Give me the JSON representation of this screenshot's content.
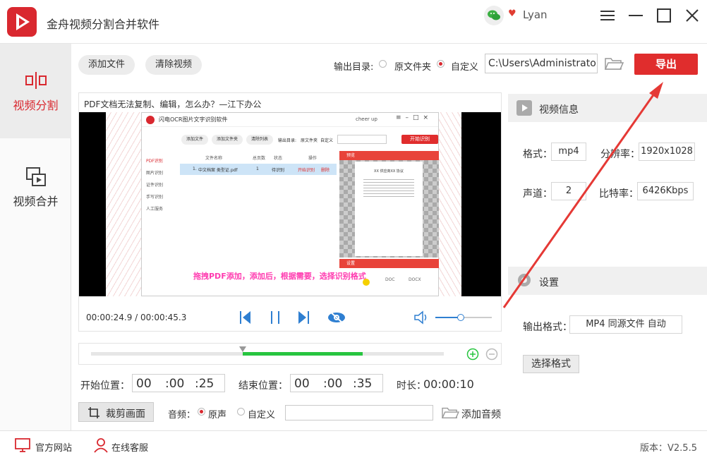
{
  "app": {
    "title": "金舟视频分割合并软件",
    "user": "Lyan"
  },
  "nav": {
    "split": "视频分割",
    "merge": "视频合并"
  },
  "toolbar": {
    "add_file": "添加文件",
    "clear_video": "清除视频",
    "output_dir_label": "输出目录:",
    "opt_source": "原文件夹",
    "opt_custom": "自定义",
    "output_path": "C:\\Users\\Administrator\\",
    "export": "导出"
  },
  "preview": {
    "video_title": "PDF文档无法复制、编辑，怎么办？—江下办公",
    "inner_app_title": "闪电OCR图片文字识别软件",
    "inner_user": "cheer up",
    "inner_buttons": [
      "添加文件",
      "添加文件夹",
      "清除列表"
    ],
    "inner_output_label": "输出目录:",
    "inner_opt_source": "原文件夹",
    "inner_opt_custom": "自定义",
    "inner_start": "开始识别",
    "inner_nav": [
      "PDF识别",
      "图片识别",
      "证件识别",
      "手写识别",
      "人工服务"
    ],
    "inner_table_headers": [
      "文件名称",
      "总页数",
      "状态",
      "操作"
    ],
    "inner_row": {
      "index": "1.",
      "name": "中文档案 类型证.pdf",
      "pages": "1",
      "status": "待识别",
      "action": "开始识别",
      "delete": "删除"
    },
    "inner_panel_title": "预览",
    "inner_settings_title": "设置",
    "inner_doc_title": "XX 供应商XX 协议",
    "inner_formats": [
      "DOC",
      "DOCX"
    ],
    "subtitle": "拖拽PDF添加，添加后，根据需要，选择识别格式",
    "time_current": "00:00:24.9",
    "time_total": "00:00:45.3",
    "volume": 0.45
  },
  "info": {
    "header": "视频信息",
    "format_label": "格式：",
    "format": "mp4",
    "resolution_label": "分辨率：",
    "resolution": "1920x1028",
    "channel_label": "声道：",
    "channel": "2",
    "bitrate_label": "比特率：",
    "bitrate": "6426Kbps"
  },
  "settings": {
    "header": "设置",
    "output_format_label": "输出格式：",
    "output_format": "MP4 同源文件 自动",
    "choose_format": "选择格式"
  },
  "timeline": {
    "selection_start": 0.43,
    "selection_end": 0.77,
    "cursor": 0.43
  },
  "trim": {
    "start_label": "开始位置：",
    "start": [
      "00",
      ":00",
      ":25"
    ],
    "end_label": "结束位置：",
    "end": [
      "00",
      ":00",
      ":35"
    ],
    "duration_label": "时长：",
    "duration": "00:00:10"
  },
  "audio": {
    "crop_button": "裁剪画面",
    "label": "音频：",
    "opt_original": "原声",
    "opt_custom": "自定义",
    "custom_path": "",
    "add_audio": "添加音频"
  },
  "footer": {
    "website": "官方网站",
    "support": "在线客服",
    "version_label": "版本：",
    "version": "V2.5.5"
  },
  "colors": {
    "accent": "#e02d2d",
    "highlight_green": "#27c53f",
    "play_blue": "#2f7fd1"
  }
}
